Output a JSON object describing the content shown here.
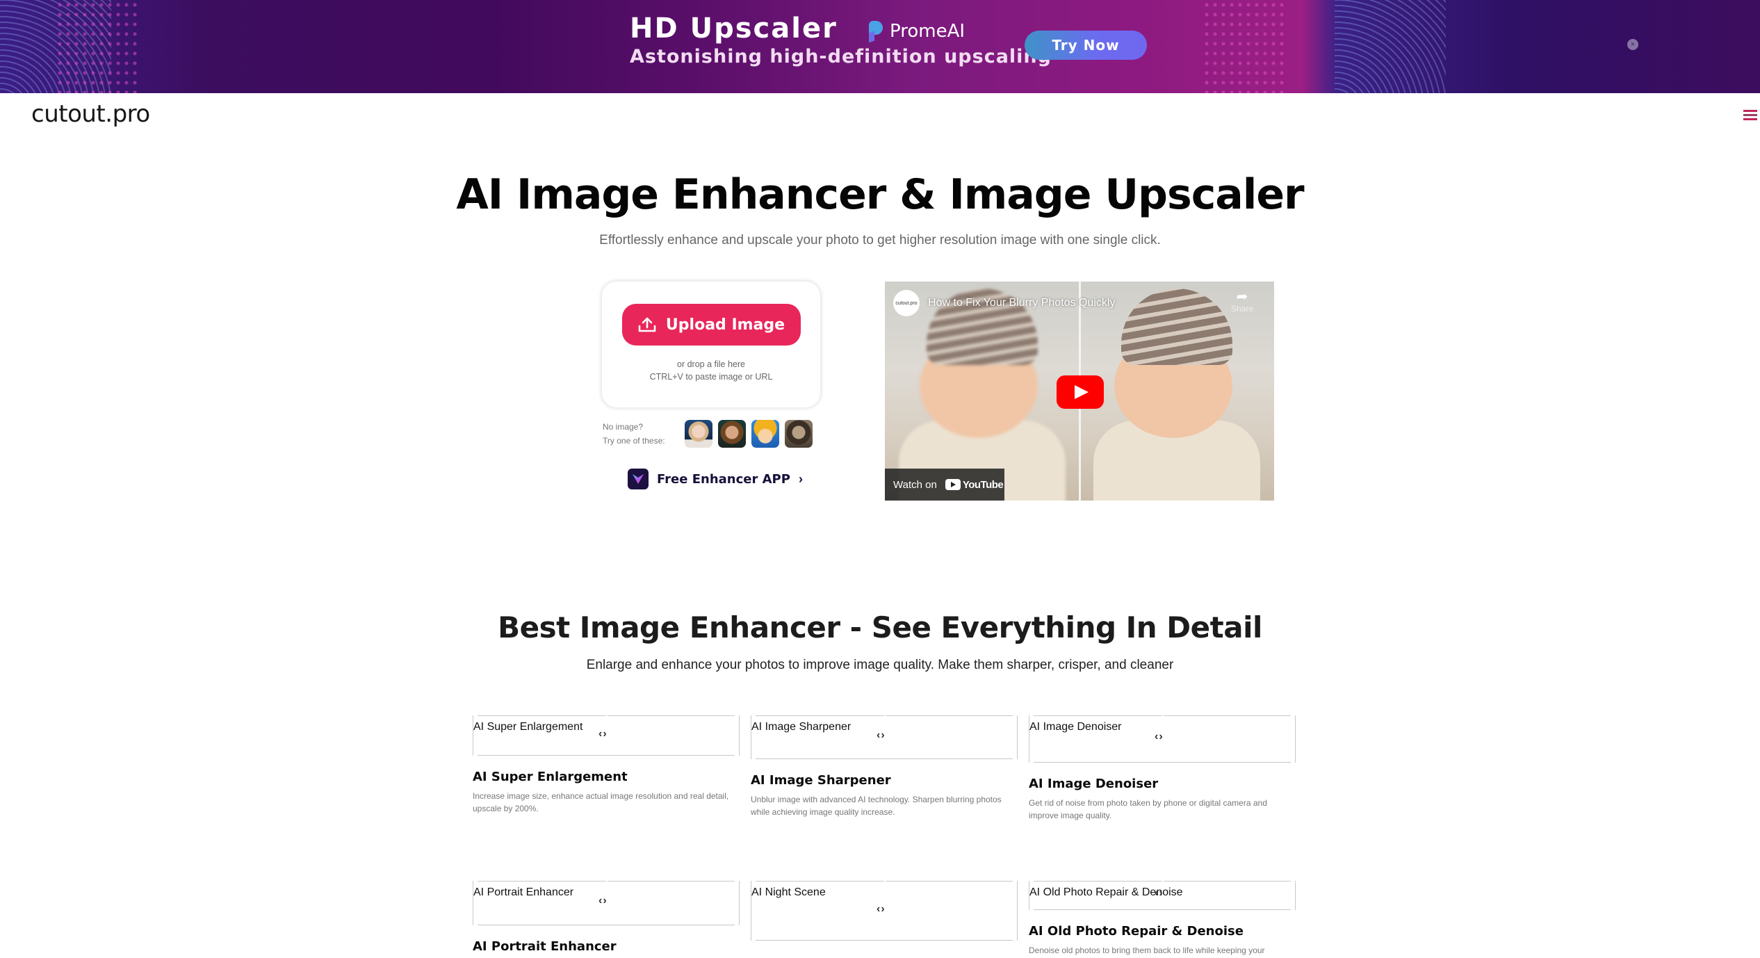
{
  "ad": {
    "title": "HD Upscaler",
    "subtitle": "Astonishing high-definition upscaling",
    "brand": "PromeAI",
    "cta": "Try Now",
    "close": "×"
  },
  "header": {
    "logo": "cutout.pro",
    "menu_icon": "hamburger-icon"
  },
  "hero": {
    "title": "AI Image Enhancer & Image Upscaler",
    "subtitle": "Effortlessly enhance and upscale your photo to get higher resolution image with one single click.",
    "upload_label": "Upload Image",
    "drop_line1": "or drop a file here",
    "drop_line2": "CTRL+V to paste image or URL",
    "samples_line1": "No image?",
    "samples_line2": "Try one of these:",
    "samples": [
      "sample-girl",
      "sample-woman",
      "sample-anime",
      "sample-vintage"
    ],
    "app_label": "Free Enhancer APP",
    "app_chevron": "›"
  },
  "video": {
    "channel": "cutout.pro",
    "title": "How to Fix Your Blurry Photos Quickly",
    "share_label": "Share",
    "watch_on": "Watch on",
    "youtube": "YouTube"
  },
  "features": {
    "title": "Best Image Enhancer - See Everything In Detail",
    "subtitle": "Enlarge and enhance your photos to improve image quality. Make them sharper, crisper, and cleaner",
    "handle": "‹›",
    "items": [
      {
        "label": "AI Super Enlargement",
        "title": "AI Super Enlargement",
        "desc": "Increase image size, enhance actual image resolution and real detail, upscale by 200%."
      },
      {
        "label": "AI Image Sharpener",
        "title": "AI Image Sharpener",
        "desc": "Unblur image with advanced AI technology. Sharpen blurring photos while achieving image quality increase."
      },
      {
        "label": "AI Image Denoiser",
        "title": "AI Image Denoiser",
        "desc": "Get rid of noise from photo taken by phone or digital camera and improve image quality."
      },
      {
        "label": "AI Portrait Enhancer",
        "title": "AI Portrait Enhancer",
        "desc": ""
      },
      {
        "label": "AI Night Scene",
        "title": "",
        "desc": ""
      },
      {
        "label": "AI Old Photo Repair & Denoise",
        "title": "AI Old Photo Repair & Denoise",
        "desc": "Denoise old photos to bring them back to life while keeping your"
      }
    ]
  }
}
